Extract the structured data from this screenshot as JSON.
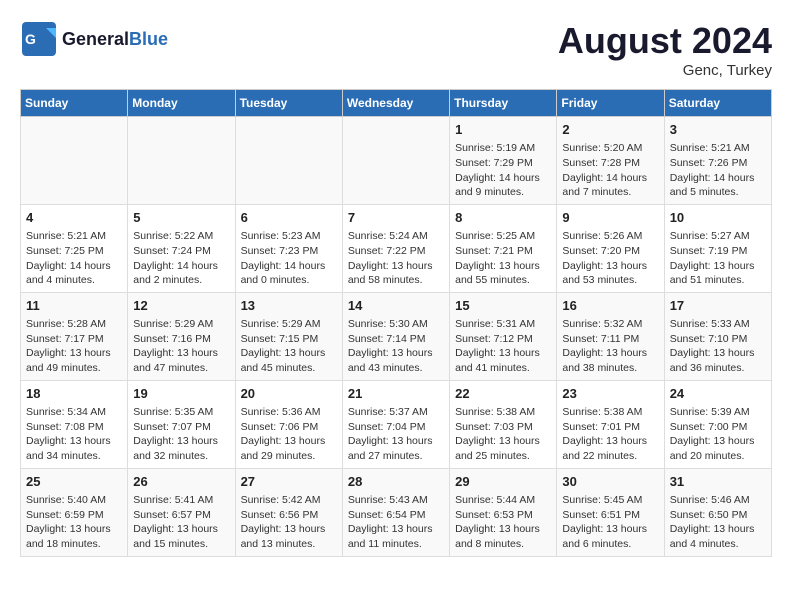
{
  "header": {
    "logo_line1": "General",
    "logo_line2": "Blue",
    "month_year": "August 2024",
    "location": "Genc, Turkey"
  },
  "weekdays": [
    "Sunday",
    "Monday",
    "Tuesday",
    "Wednesday",
    "Thursday",
    "Friday",
    "Saturday"
  ],
  "weeks": [
    [
      {
        "day": "",
        "content": ""
      },
      {
        "day": "",
        "content": ""
      },
      {
        "day": "",
        "content": ""
      },
      {
        "day": "",
        "content": ""
      },
      {
        "day": "1",
        "content": "Sunrise: 5:19 AM\nSunset: 7:29 PM\nDaylight: 14 hours\nand 9 minutes."
      },
      {
        "day": "2",
        "content": "Sunrise: 5:20 AM\nSunset: 7:28 PM\nDaylight: 14 hours\nand 7 minutes."
      },
      {
        "day": "3",
        "content": "Sunrise: 5:21 AM\nSunset: 7:26 PM\nDaylight: 14 hours\nand 5 minutes."
      }
    ],
    [
      {
        "day": "4",
        "content": "Sunrise: 5:21 AM\nSunset: 7:25 PM\nDaylight: 14 hours\nand 4 minutes."
      },
      {
        "day": "5",
        "content": "Sunrise: 5:22 AM\nSunset: 7:24 PM\nDaylight: 14 hours\nand 2 minutes."
      },
      {
        "day": "6",
        "content": "Sunrise: 5:23 AM\nSunset: 7:23 PM\nDaylight: 14 hours\nand 0 minutes."
      },
      {
        "day": "7",
        "content": "Sunrise: 5:24 AM\nSunset: 7:22 PM\nDaylight: 13 hours\nand 58 minutes."
      },
      {
        "day": "8",
        "content": "Sunrise: 5:25 AM\nSunset: 7:21 PM\nDaylight: 13 hours\nand 55 minutes."
      },
      {
        "day": "9",
        "content": "Sunrise: 5:26 AM\nSunset: 7:20 PM\nDaylight: 13 hours\nand 53 minutes."
      },
      {
        "day": "10",
        "content": "Sunrise: 5:27 AM\nSunset: 7:19 PM\nDaylight: 13 hours\nand 51 minutes."
      }
    ],
    [
      {
        "day": "11",
        "content": "Sunrise: 5:28 AM\nSunset: 7:17 PM\nDaylight: 13 hours\nand 49 minutes."
      },
      {
        "day": "12",
        "content": "Sunrise: 5:29 AM\nSunset: 7:16 PM\nDaylight: 13 hours\nand 47 minutes."
      },
      {
        "day": "13",
        "content": "Sunrise: 5:29 AM\nSunset: 7:15 PM\nDaylight: 13 hours\nand 45 minutes."
      },
      {
        "day": "14",
        "content": "Sunrise: 5:30 AM\nSunset: 7:14 PM\nDaylight: 13 hours\nand 43 minutes."
      },
      {
        "day": "15",
        "content": "Sunrise: 5:31 AM\nSunset: 7:12 PM\nDaylight: 13 hours\nand 41 minutes."
      },
      {
        "day": "16",
        "content": "Sunrise: 5:32 AM\nSunset: 7:11 PM\nDaylight: 13 hours\nand 38 minutes."
      },
      {
        "day": "17",
        "content": "Sunrise: 5:33 AM\nSunset: 7:10 PM\nDaylight: 13 hours\nand 36 minutes."
      }
    ],
    [
      {
        "day": "18",
        "content": "Sunrise: 5:34 AM\nSunset: 7:08 PM\nDaylight: 13 hours\nand 34 minutes."
      },
      {
        "day": "19",
        "content": "Sunrise: 5:35 AM\nSunset: 7:07 PM\nDaylight: 13 hours\nand 32 minutes."
      },
      {
        "day": "20",
        "content": "Sunrise: 5:36 AM\nSunset: 7:06 PM\nDaylight: 13 hours\nand 29 minutes."
      },
      {
        "day": "21",
        "content": "Sunrise: 5:37 AM\nSunset: 7:04 PM\nDaylight: 13 hours\nand 27 minutes."
      },
      {
        "day": "22",
        "content": "Sunrise: 5:38 AM\nSunset: 7:03 PM\nDaylight: 13 hours\nand 25 minutes."
      },
      {
        "day": "23",
        "content": "Sunrise: 5:38 AM\nSunset: 7:01 PM\nDaylight: 13 hours\nand 22 minutes."
      },
      {
        "day": "24",
        "content": "Sunrise: 5:39 AM\nSunset: 7:00 PM\nDaylight: 13 hours\nand 20 minutes."
      }
    ],
    [
      {
        "day": "25",
        "content": "Sunrise: 5:40 AM\nSunset: 6:59 PM\nDaylight: 13 hours\nand 18 minutes."
      },
      {
        "day": "26",
        "content": "Sunrise: 5:41 AM\nSunset: 6:57 PM\nDaylight: 13 hours\nand 15 minutes."
      },
      {
        "day": "27",
        "content": "Sunrise: 5:42 AM\nSunset: 6:56 PM\nDaylight: 13 hours\nand 13 minutes."
      },
      {
        "day": "28",
        "content": "Sunrise: 5:43 AM\nSunset: 6:54 PM\nDaylight: 13 hours\nand 11 minutes."
      },
      {
        "day": "29",
        "content": "Sunrise: 5:44 AM\nSunset: 6:53 PM\nDaylight: 13 hours\nand 8 minutes."
      },
      {
        "day": "30",
        "content": "Sunrise: 5:45 AM\nSunset: 6:51 PM\nDaylight: 13 hours\nand 6 minutes."
      },
      {
        "day": "31",
        "content": "Sunrise: 5:46 AM\nSunset: 6:50 PM\nDaylight: 13 hours\nand 4 minutes."
      }
    ]
  ]
}
